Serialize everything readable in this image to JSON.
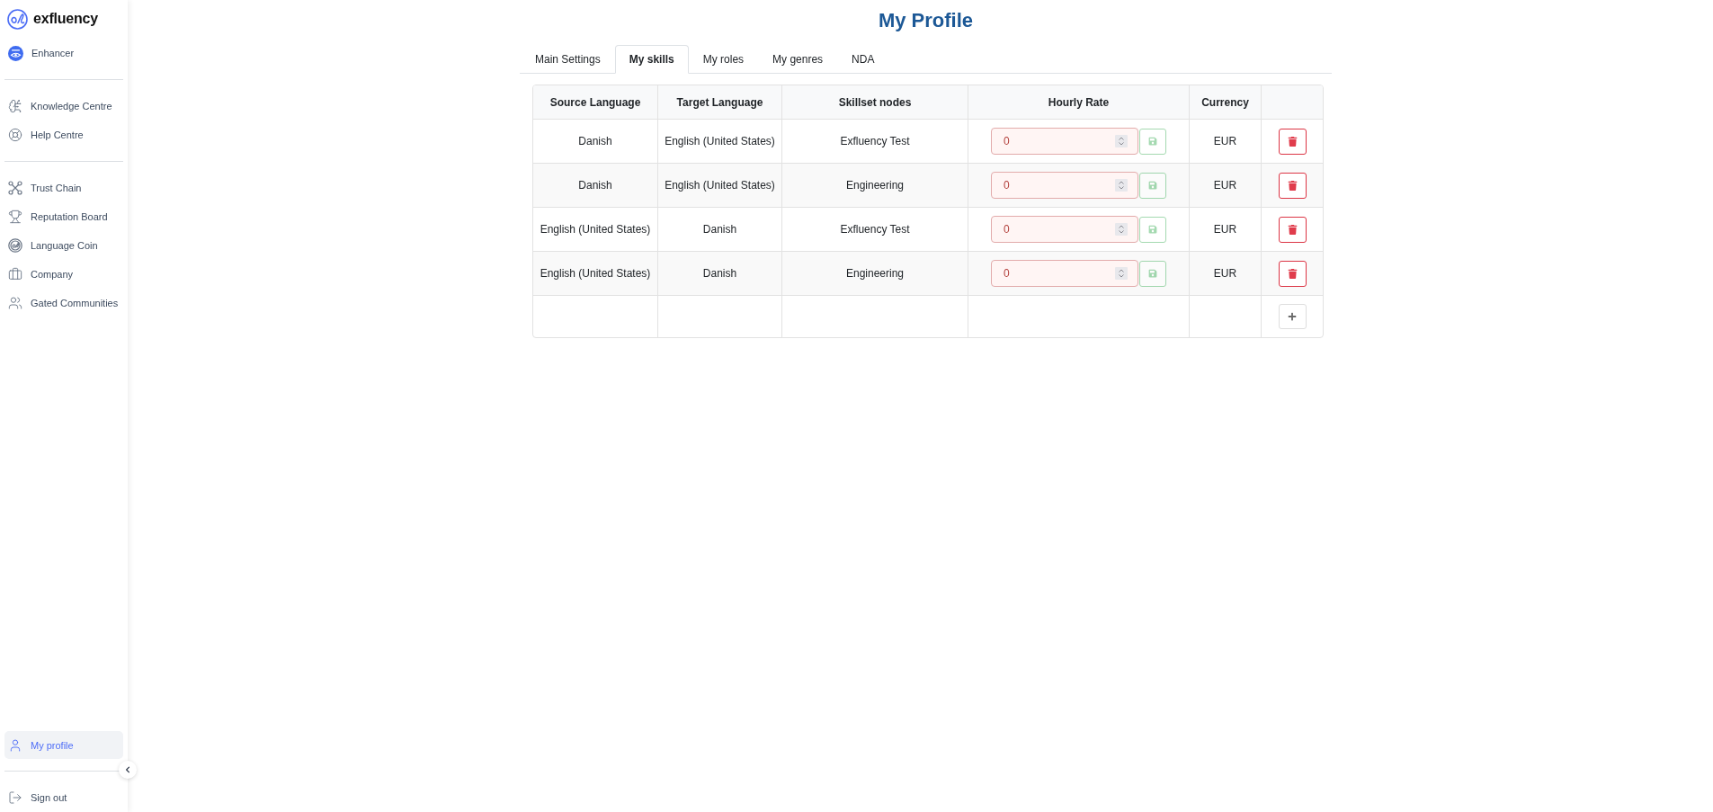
{
  "sidebar": {
    "brand": "exfluency",
    "sections": [
      {
        "items": [
          {
            "label": "Enhancer",
            "selected": false
          }
        ]
      },
      {
        "items": [
          {
            "label": "Knowledge Centre",
            "selected": false
          },
          {
            "label": "Help Centre",
            "selected": false
          }
        ]
      },
      {
        "items": [
          {
            "label": "Trust Chain",
            "selected": false
          },
          {
            "label": "Reputation Board",
            "selected": false
          },
          {
            "label": "Language Coin",
            "selected": false
          },
          {
            "label": "Company",
            "selected": false
          },
          {
            "label": "Gated Communities",
            "selected": false
          }
        ]
      }
    ],
    "bottom_items": [
      {
        "label": "My profile",
        "selected": true
      }
    ],
    "sign_out": "Sign out"
  },
  "title": "My Profile",
  "tabs": [
    {
      "label": "Main Settings",
      "selected": false
    },
    {
      "label": "My skills",
      "selected": true
    },
    {
      "label": "My roles",
      "selected": false
    },
    {
      "label": "My genres",
      "selected": false
    },
    {
      "label": "NDA",
      "selected": false
    }
  ],
  "table": {
    "columns": [
      "Source Language",
      "Target Language",
      "Skillset nodes",
      "Hourly Rate",
      "Currency"
    ],
    "rows": [
      {
        "source_language": "Danish",
        "target_language": "English (United States)",
        "skillset_node": "Exfluency Test",
        "hourly_rate": "0",
        "rate_invalid": true,
        "save_disabled": true,
        "currency": "EUR"
      },
      {
        "source_language": "Danish",
        "target_language": "English (United States)",
        "skillset_node": "Engineering",
        "hourly_rate": "0",
        "rate_invalid": true,
        "save_disabled": true,
        "currency": "EUR"
      },
      {
        "source_language": "English (United States)",
        "target_language": "Danish",
        "skillset_node": "Exfluency Test",
        "hourly_rate": "0",
        "rate_invalid": true,
        "save_disabled": true,
        "currency": "EUR"
      },
      {
        "source_language": "English (United States)",
        "target_language": "Danish",
        "skillset_node": "Engineering",
        "hourly_rate": "0",
        "rate_invalid": true,
        "save_disabled": true,
        "currency": "EUR"
      }
    ]
  }
}
